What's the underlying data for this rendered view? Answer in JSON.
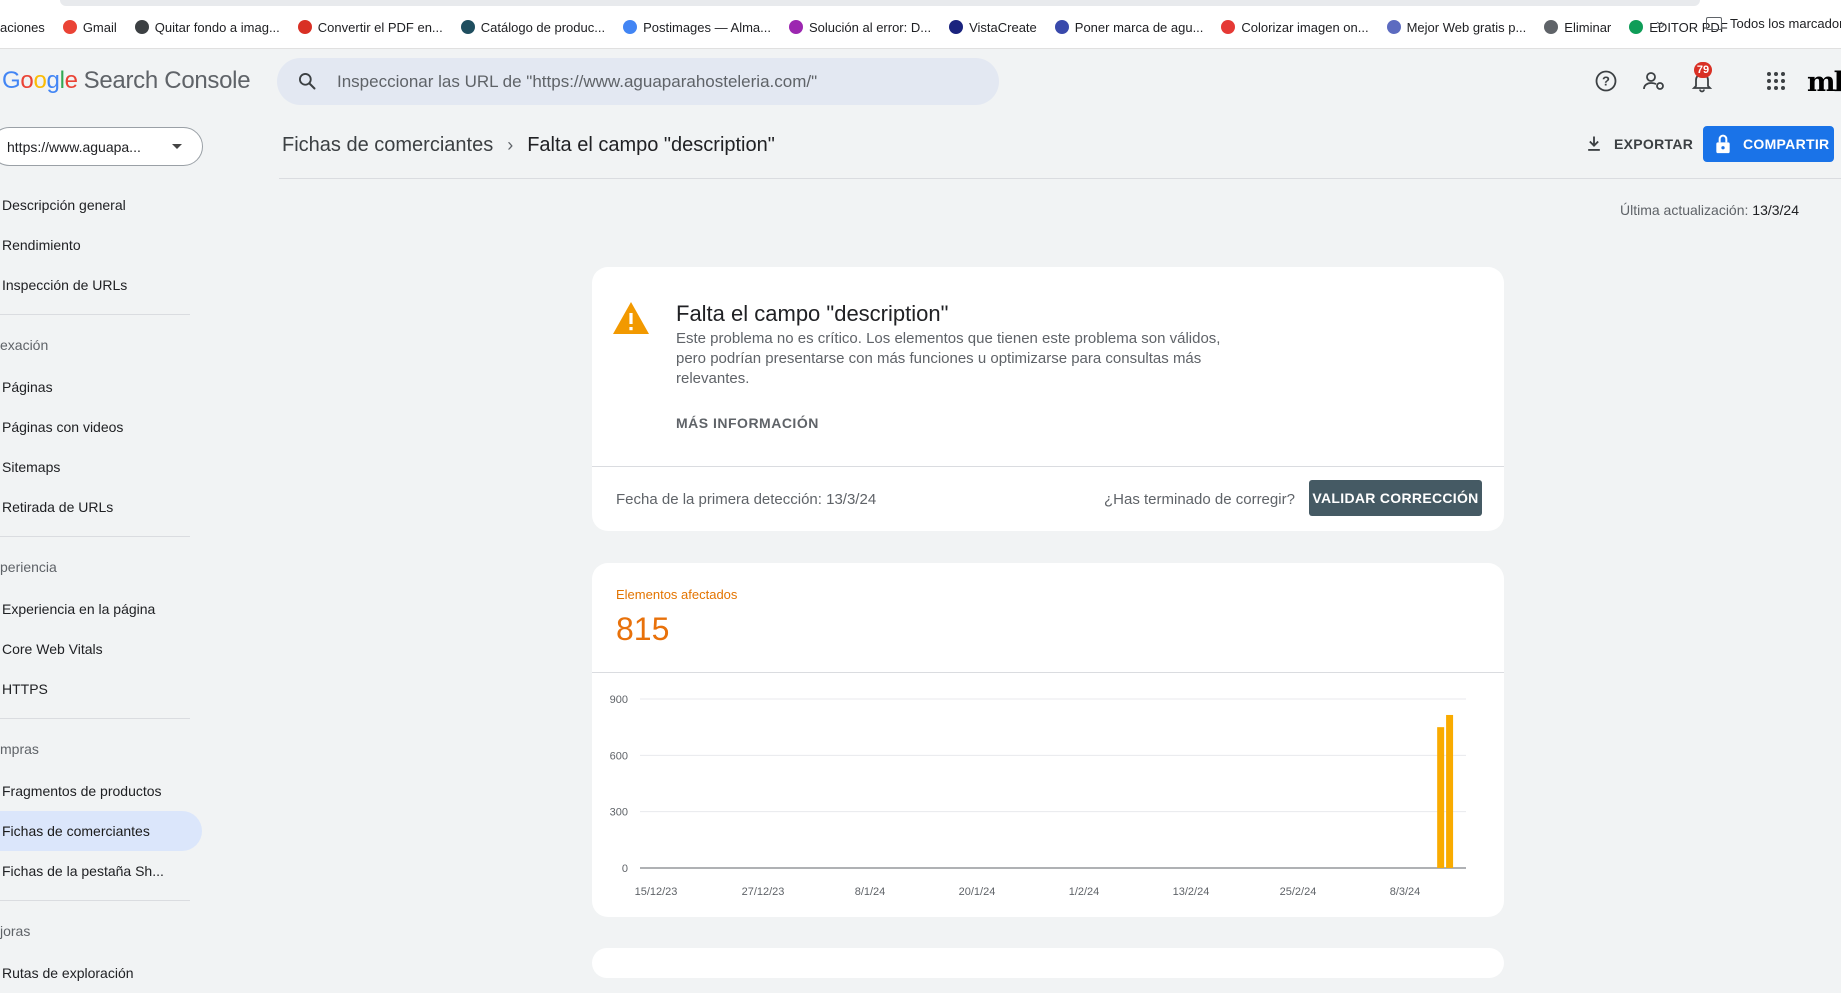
{
  "bookmarks": {
    "items": [
      {
        "label": "aciones",
        "icon": "none-icon",
        "color": ""
      },
      {
        "label": "Gmail",
        "icon": "gmail-icon",
        "color": "#ea4335"
      },
      {
        "label": "Quitar fondo a imag...",
        "icon": "removebg-icon",
        "color": "#3c4043"
      },
      {
        "label": "Convertir el PDF en...",
        "icon": "pdf-icon",
        "color": "#d93025"
      },
      {
        "label": "Catálogo de produc...",
        "icon": "info-icon",
        "color": "#1f4e5f"
      },
      {
        "label": "Postimages — Alma...",
        "icon": "postimages-icon",
        "color": "#4285f4"
      },
      {
        "label": "Solución al error: D...",
        "icon": "solution-icon",
        "color": "#9c27b0"
      },
      {
        "label": "VistaCreate",
        "icon": "vistacreate-icon",
        "color": "#1a237e"
      },
      {
        "label": "Poner marca de agu...",
        "icon": "watermark-icon",
        "color": "#3949ab"
      },
      {
        "label": "Colorizar imagen on...",
        "icon": "colorize-icon",
        "color": "#e53935"
      },
      {
        "label": "Mejor Web gratis p...",
        "icon": "web-icon",
        "color": "#5c6bc0"
      },
      {
        "label": "Eliminar",
        "icon": "delete-icon",
        "color": "#5f6368"
      },
      {
        "label": "EDITOR PDF",
        "icon": "editor-pdf-icon",
        "color": "#0f9d58"
      }
    ],
    "more": "»",
    "all_label": "Todos los marcadores"
  },
  "header": {
    "logo_google": "Google",
    "logo_product": "Search Console",
    "search_placeholder": "Inspeccionar las URL de \"https://www.aguaparahosteleria.com/\"",
    "notifications_count": "79",
    "avatar": "mk"
  },
  "sidebar": {
    "property": "https://www.aguapa...",
    "items": [
      {
        "label": "Descripción general",
        "type": "item"
      },
      {
        "label": "Rendimiento",
        "type": "item"
      },
      {
        "label": "Inspección de URLs",
        "type": "item"
      },
      {
        "label": "exación",
        "type": "section"
      },
      {
        "label": "Páginas",
        "type": "item"
      },
      {
        "label": "Páginas con videos",
        "type": "item"
      },
      {
        "label": "Sitemaps",
        "type": "item"
      },
      {
        "label": "Retirada de URLs",
        "type": "item"
      },
      {
        "label": "periencia",
        "type": "section"
      },
      {
        "label": "Experiencia en la página",
        "type": "item"
      },
      {
        "label": "Core Web Vitals",
        "type": "item"
      },
      {
        "label": "HTTPS",
        "type": "item"
      },
      {
        "label": "mpras",
        "type": "section"
      },
      {
        "label": "Fragmentos de productos",
        "type": "item"
      },
      {
        "label": "Fichas de comerciantes",
        "type": "item",
        "active": true
      },
      {
        "label": "Fichas de la pestaña Sh...",
        "type": "item"
      },
      {
        "label": "joras",
        "type": "section"
      },
      {
        "label": "Rutas de exploración",
        "type": "item"
      }
    ]
  },
  "page": {
    "breadcrumb_parent": "Fichas de comerciantes",
    "breadcrumb_current": "Falta el campo \"description\"",
    "export_label": "EXPORTAR",
    "share_label": "COMPARTIR",
    "last_update_label": "Última actualización:",
    "last_update_date": "13/3/24"
  },
  "issue": {
    "title": "Falta el campo \"description\"",
    "description": "Este problema no es crítico. Los elementos que tienen este problema son válidos, pero podrían presentarse con más funciones u optimizarse para consultas más relevantes.",
    "more_info": "MÁS INFORMACIÓN",
    "first_detection": "Fecha de la primera detección: 13/3/24",
    "fixed_question": "¿Has terminado de corregir?",
    "validate_label": "VALIDAR CORRECCIÓN"
  },
  "affected": {
    "label": "Elementos afectados",
    "value": "815"
  },
  "chart_data": {
    "type": "bar",
    "y_ticks": [
      0,
      300,
      600,
      900
    ],
    "ylim": [
      0,
      900
    ],
    "x_ticks": [
      "15/12/23",
      "27/12/23",
      "8/1/24",
      "20/1/24",
      "1/2/24",
      "13/2/24",
      "25/2/24",
      "8/3/24"
    ],
    "series": [
      {
        "x": [
          "12/3/24",
          "13/3/24"
        ],
        "values": [
          750,
          815
        ],
        "color": "#f9ab00"
      }
    ],
    "grid": true
  }
}
